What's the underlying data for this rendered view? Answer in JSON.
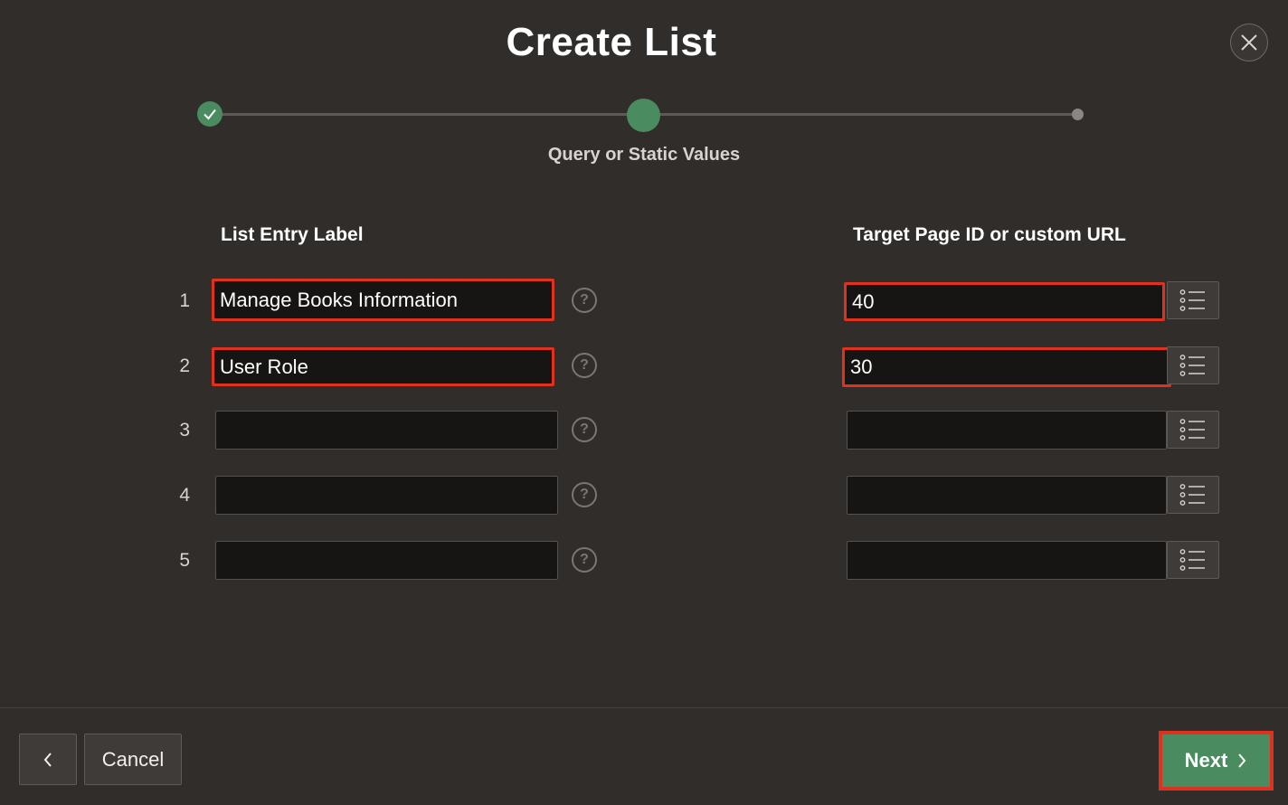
{
  "dialog": {
    "title": "Create List",
    "close_icon": "close-icon"
  },
  "wizard": {
    "steps": [
      {
        "state": "complete",
        "icon": "check-icon"
      },
      {
        "state": "current"
      },
      {
        "state": "upcoming"
      }
    ],
    "current_step_label": "Query or Static Values",
    "accent_color": "#4a8b5f"
  },
  "columns": {
    "label_header": "List Entry Label",
    "target_header": "Target Page ID or custom URL"
  },
  "rows": [
    {
      "number": "1",
      "label": "Manage Books Information",
      "target": "40"
    },
    {
      "number": "2",
      "label": "User Role",
      "target": "30"
    },
    {
      "number": "3",
      "label": "",
      "target": ""
    },
    {
      "number": "4",
      "label": "",
      "target": ""
    },
    {
      "number": "5",
      "label": "",
      "target": ""
    }
  ],
  "icons": {
    "help": "help-icon",
    "list": "list-icon"
  },
  "footer": {
    "back_icon": "chevron-left-icon",
    "cancel_label": "Cancel",
    "next_label": "Next",
    "next_icon": "chevron-right-icon"
  },
  "highlight_color": "#e0301e"
}
